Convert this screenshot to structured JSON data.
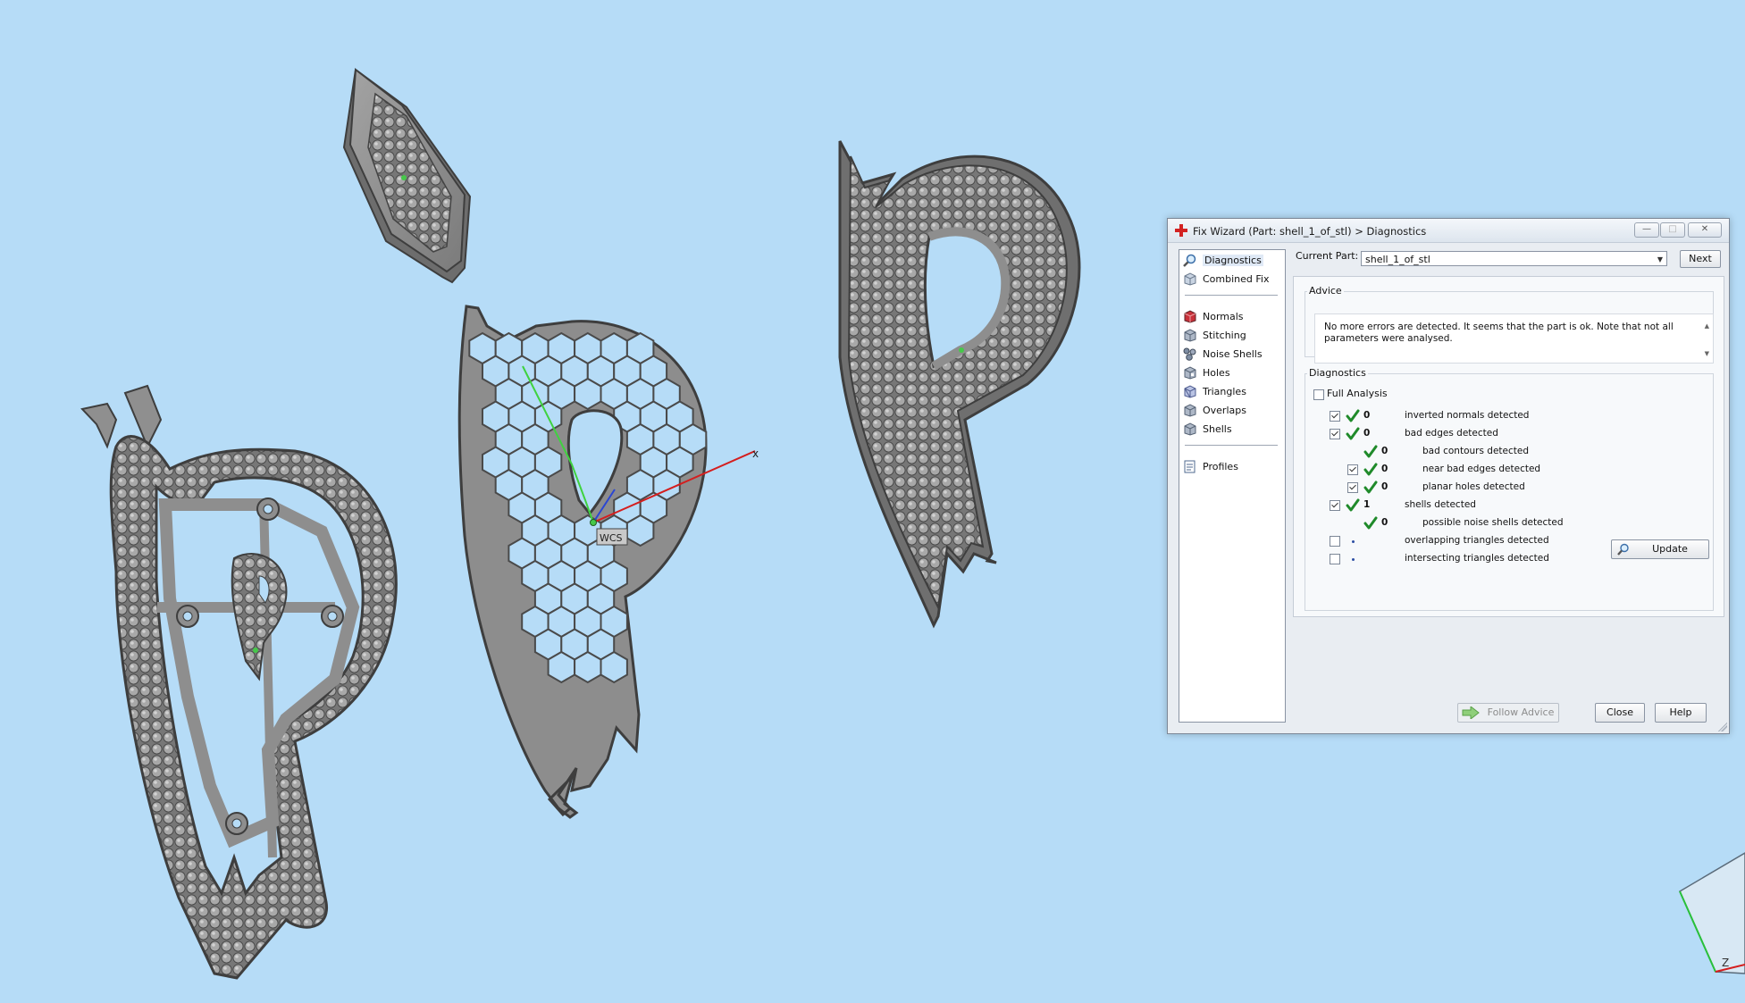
{
  "viewport": {
    "axis_x_label": "x",
    "axis_z_label": "Z",
    "wcs_label": "WCS",
    "background_color": "#b6dcf7",
    "part_color": "#8d8d8d"
  },
  "dialog": {
    "title": "Fix Wizard (Part: shell_1_of_stl) > Diagnostics",
    "title_icon": "red-cross-icon",
    "window_buttons": [
      "minimize",
      "maximize",
      "close"
    ],
    "nav": {
      "group1": [
        {
          "label": "Diagnostics",
          "icon": "magnifier-icon",
          "active": true
        },
        {
          "label": "Combined Fix",
          "icon": "cube-icon"
        }
      ],
      "group2": [
        {
          "label": "Normals",
          "icon": "normals-cube-icon"
        },
        {
          "label": "Stitching",
          "icon": "stitching-cube-icon"
        },
        {
          "label": "Noise Shells",
          "icon": "noise-shells-icon"
        },
        {
          "label": "Holes",
          "icon": "holes-cube-icon"
        },
        {
          "label": "Triangles",
          "icon": "triangles-cube-icon"
        },
        {
          "label": "Overlaps",
          "icon": "overlaps-cube-icon"
        },
        {
          "label": "Shells",
          "icon": "shells-cube-icon"
        }
      ],
      "group3": [
        {
          "label": "Profiles",
          "icon": "profiles-document-icon"
        }
      ]
    },
    "current_part_label": "Current Part:",
    "current_part_value": "shell_1_of_stl",
    "next_label": "Next",
    "advice": {
      "title": "Advice",
      "text": "No more errors are detected. It seems that the part is ok. Note that not all parameters were analysed."
    },
    "diagnostics": {
      "title": "Diagnostics",
      "full_analysis_label": "Full Analysis",
      "full_analysis_checked": false,
      "rows": [
        {
          "checked": true,
          "status": "ok",
          "count": "0",
          "label": "inverted normals detected",
          "indent": 0
        },
        {
          "checked": true,
          "status": "ok",
          "count": "0",
          "label": "bad edges detected",
          "indent": 0
        },
        {
          "checkbox": false,
          "status": "ok",
          "count": "0",
          "label": "bad contours detected",
          "indent": 1
        },
        {
          "checked": true,
          "status": "ok",
          "count": "0",
          "label": "near bad edges detected",
          "indent": 1
        },
        {
          "checked": true,
          "status": "ok",
          "count": "0",
          "label": "planar holes detected",
          "indent": 1
        },
        {
          "checked": true,
          "status": "ok",
          "count": "1",
          "label": "shells detected",
          "indent": 0
        },
        {
          "checkbox": false,
          "status": "ok",
          "count": "0",
          "label": "possible noise shells detected",
          "indent": 1
        },
        {
          "checked": false,
          "status": "none",
          "count": "",
          "label": "overlapping triangles detected",
          "indent": 0
        },
        {
          "checked": false,
          "status": "none",
          "count": "",
          "label": "intersecting triangles detected",
          "indent": 0
        }
      ],
      "update_label": "Update"
    },
    "follow_advice_label": "Follow Advice",
    "close_label": "Close",
    "help_label": "Help",
    "colors": {
      "ok_check": "#1f8a2a",
      "accent_red": "#d32222",
      "disabled_text": "#8c8c8c"
    }
  }
}
